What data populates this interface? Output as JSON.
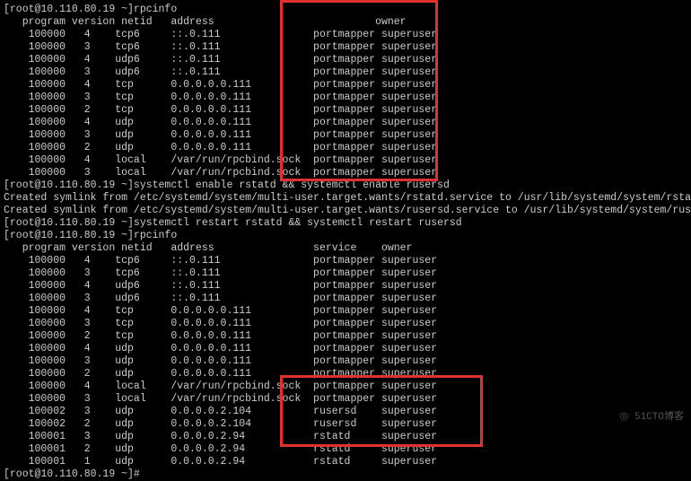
{
  "host": "10.110.80.19",
  "user": "root",
  "prompt_prefix": "[root@10.110.80.19 ~]",
  "commands": {
    "rpcinfo": "rpcinfo",
    "enable": "systemctl enable rstatd && systemctl enable rusersd",
    "restart": "systemctl restart rstatd && systemctl restart rusersd"
  },
  "header": {
    "program": "program",
    "version": "version",
    "netid": "netid",
    "address": "address",
    "service": "service",
    "owner": "owner"
  },
  "symlinks": [
    "Created symlink from /etc/systemd/system/multi-user.target.wants/rstatd.service to /usr/lib/systemd/system/rstatd.service.",
    "Created symlink from /etc/systemd/system/multi-user.target.wants/rusersd.service to /usr/lib/systemd/system/rusersd.service."
  ],
  "table1": [
    {
      "program": "100000",
      "version": "4",
      "netid": "tcp6",
      "address": "::.0.111",
      "service": "portmapper",
      "owner": "superuser"
    },
    {
      "program": "100000",
      "version": "3",
      "netid": "tcp6",
      "address": "::.0.111",
      "service": "portmapper",
      "owner": "superuser"
    },
    {
      "program": "100000",
      "version": "4",
      "netid": "udp6",
      "address": "::.0.111",
      "service": "portmapper",
      "owner": "superuser"
    },
    {
      "program": "100000",
      "version": "3",
      "netid": "udp6",
      "address": "::.0.111",
      "service": "portmapper",
      "owner": "superuser"
    },
    {
      "program": "100000",
      "version": "4",
      "netid": "tcp",
      "address": "0.0.0.0.0.111",
      "service": "portmapper",
      "owner": "superuser"
    },
    {
      "program": "100000",
      "version": "3",
      "netid": "tcp",
      "address": "0.0.0.0.0.111",
      "service": "portmapper",
      "owner": "superuser"
    },
    {
      "program": "100000",
      "version": "2",
      "netid": "tcp",
      "address": "0.0.0.0.0.111",
      "service": "portmapper",
      "owner": "superuser"
    },
    {
      "program": "100000",
      "version": "4",
      "netid": "udp",
      "address": "0.0.0.0.0.111",
      "service": "portmapper",
      "owner": "superuser"
    },
    {
      "program": "100000",
      "version": "3",
      "netid": "udp",
      "address": "0.0.0.0.0.111",
      "service": "portmapper",
      "owner": "superuser"
    },
    {
      "program": "100000",
      "version": "2",
      "netid": "udp",
      "address": "0.0.0.0.0.111",
      "service": "portmapper",
      "owner": "superuser"
    },
    {
      "program": "100000",
      "version": "4",
      "netid": "local",
      "address": "/var/run/rpcbind.sock",
      "service": "portmapper",
      "owner": "superuser"
    },
    {
      "program": "100000",
      "version": "3",
      "netid": "local",
      "address": "/var/run/rpcbind.sock",
      "service": "portmapper",
      "owner": "superuser"
    }
  ],
  "table2": [
    {
      "program": "100000",
      "version": "4",
      "netid": "tcp6",
      "address": "::.0.111",
      "service": "portmapper",
      "owner": "superuser"
    },
    {
      "program": "100000",
      "version": "3",
      "netid": "tcp6",
      "address": "::.0.111",
      "service": "portmapper",
      "owner": "superuser"
    },
    {
      "program": "100000",
      "version": "4",
      "netid": "udp6",
      "address": "::.0.111",
      "service": "portmapper",
      "owner": "superuser"
    },
    {
      "program": "100000",
      "version": "3",
      "netid": "udp6",
      "address": "::.0.111",
      "service": "portmapper",
      "owner": "superuser"
    },
    {
      "program": "100000",
      "version": "4",
      "netid": "tcp",
      "address": "0.0.0.0.0.111",
      "service": "portmapper",
      "owner": "superuser"
    },
    {
      "program": "100000",
      "version": "3",
      "netid": "tcp",
      "address": "0.0.0.0.0.111",
      "service": "portmapper",
      "owner": "superuser"
    },
    {
      "program": "100000",
      "version": "2",
      "netid": "tcp",
      "address": "0.0.0.0.0.111",
      "service": "portmapper",
      "owner": "superuser"
    },
    {
      "program": "100000",
      "version": "4",
      "netid": "udp",
      "address": "0.0.0.0.0.111",
      "service": "portmapper",
      "owner": "superuser"
    },
    {
      "program": "100000",
      "version": "3",
      "netid": "udp",
      "address": "0.0.0.0.0.111",
      "service": "portmapper",
      "owner": "superuser"
    },
    {
      "program": "100000",
      "version": "2",
      "netid": "udp",
      "address": "0.0.0.0.0.111",
      "service": "portmapper",
      "owner": "superuser"
    },
    {
      "program": "100000",
      "version": "4",
      "netid": "local",
      "address": "/var/run/rpcbind.sock",
      "service": "portmapper",
      "owner": "superuser"
    },
    {
      "program": "100000",
      "version": "3",
      "netid": "local",
      "address": "/var/run/rpcbind.sock",
      "service": "portmapper",
      "owner": "superuser"
    },
    {
      "program": "100002",
      "version": "3",
      "netid": "udp",
      "address": "0.0.0.0.2.104",
      "service": "rusersd",
      "owner": "superuser"
    },
    {
      "program": "100002",
      "version": "2",
      "netid": "udp",
      "address": "0.0.0.0.2.104",
      "service": "rusersd",
      "owner": "superuser"
    },
    {
      "program": "100001",
      "version": "3",
      "netid": "udp",
      "address": "0.0.0.0.2.94",
      "service": "rstatd",
      "owner": "superuser"
    },
    {
      "program": "100001",
      "version": "2",
      "netid": "udp",
      "address": "0.0.0.0.2.94",
      "service": "rstatd",
      "owner": "superuser"
    },
    {
      "program": "100001",
      "version": "1",
      "netid": "udp",
      "address": "0.0.0.0.2.94",
      "service": "rstatd",
      "owner": "superuser"
    }
  ],
  "final_prompt": "[root@10.110.80.19 ~]#",
  "watermark": "◎ 51CTO博客"
}
